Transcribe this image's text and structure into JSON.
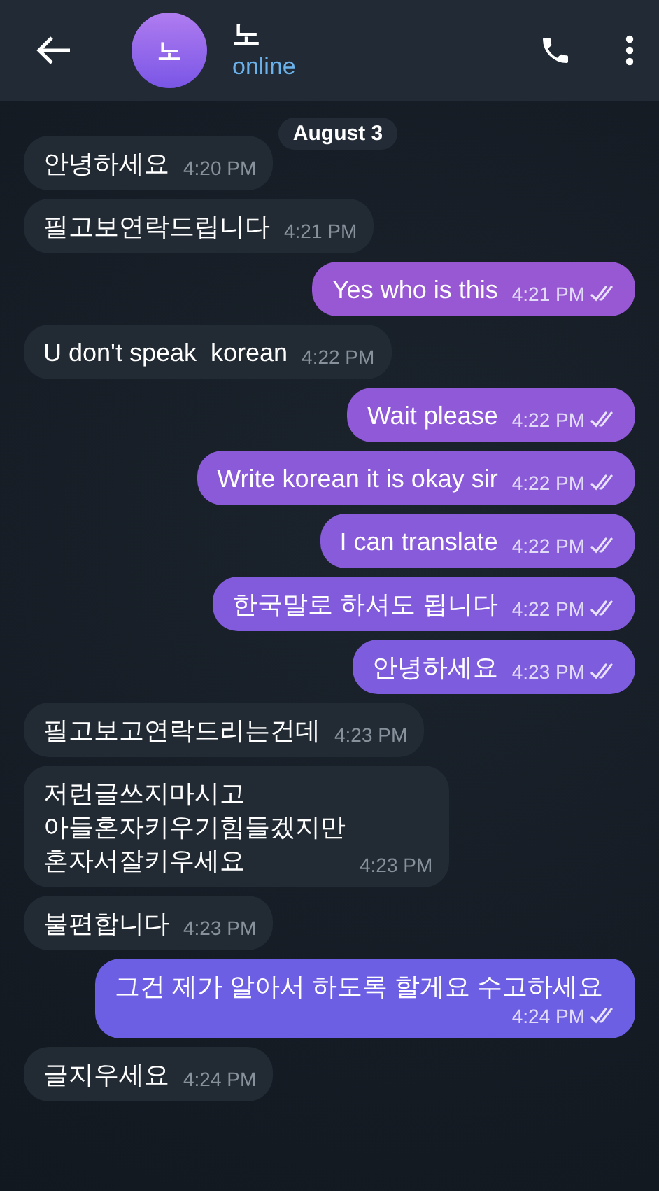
{
  "header": {
    "avatar_letter": "노",
    "name": "노",
    "status": "online"
  },
  "date": "August 3",
  "messages": [
    {
      "kind": "in",
      "text": "안녕하세요",
      "time": "4:20 PM"
    },
    {
      "kind": "in",
      "text": "필고보연락드립니다",
      "time": "4:21 PM"
    },
    {
      "kind": "out",
      "text": "Yes who is this",
      "time": "4:21 PM",
      "read": true
    },
    {
      "kind": "in",
      "text": "U don't speak  korean",
      "time": "4:22 PM"
    },
    {
      "kind": "out",
      "text": "Wait please",
      "time": "4:22 PM",
      "read": true
    },
    {
      "kind": "out",
      "text": "Write korean it is okay sir",
      "time": "4:22 PM",
      "read": true
    },
    {
      "kind": "out",
      "text": "I can translate",
      "time": "4:22 PM",
      "read": true
    },
    {
      "kind": "out",
      "text": "한국말로 하셔도 됩니다",
      "time": "4:22 PM",
      "read": true
    },
    {
      "kind": "out",
      "text": "안녕하세요",
      "time": "4:23 PM",
      "read": true
    },
    {
      "kind": "in",
      "text": "필고보고연락드리는건데",
      "time": "4:23 PM"
    },
    {
      "kind": "in",
      "text": "저런글쓰지마시고\n아들혼자키우기힘들겠지만\n혼자서잘키우세요",
      "time": "4:23 PM"
    },
    {
      "kind": "in",
      "text": "불편합니다",
      "time": "4:23 PM"
    },
    {
      "kind": "out",
      "text": "그건 제가 알아서 하도록 할게요 수고하세요",
      "time": "4:24 PM",
      "read": true
    },
    {
      "kind": "in",
      "text": "글지우세요",
      "time": "4:24 PM"
    }
  ]
}
